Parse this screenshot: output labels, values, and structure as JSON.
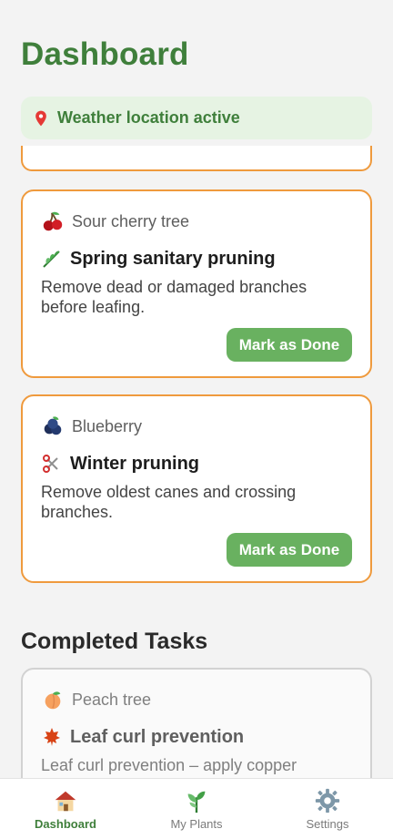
{
  "header": {
    "title": "Dashboard"
  },
  "banner": {
    "text": "Weather location active",
    "icon": "location-pin-icon"
  },
  "tasks": [
    {
      "plant": "Sour cherry tree",
      "plant_icon": "cherry-icon",
      "task": "Spring sanitary pruning",
      "task_icon": "leaf-icon",
      "description": "Remove dead or damaged branches before leafing.",
      "button": "Mark as Done"
    },
    {
      "plant": "Blueberry",
      "plant_icon": "blueberry-icon",
      "task": "Winter pruning",
      "task_icon": "scissors-icon",
      "description": "Remove oldest canes and crossing branches.",
      "button": "Mark as Done"
    }
  ],
  "completed": {
    "title": "Completed Tasks",
    "items": [
      {
        "plant": "Peach tree",
        "plant_icon": "peach-icon",
        "task": "Leaf curl prevention",
        "task_icon": "maple-leaf-icon",
        "description": "Leaf curl prevention – apply copper"
      }
    ]
  },
  "nav": {
    "items": [
      {
        "label": "Dashboard",
        "icon": "house-icon",
        "active": true
      },
      {
        "label": "My Plants",
        "icon": "herb-icon",
        "active": false
      },
      {
        "label": "Settings",
        "icon": "gear-icon",
        "active": false
      }
    ]
  },
  "colors": {
    "accent": "#3f7f3b",
    "card_border": "#ef9a3d",
    "button": "#69b160",
    "banner_bg": "#e6f3e3"
  }
}
